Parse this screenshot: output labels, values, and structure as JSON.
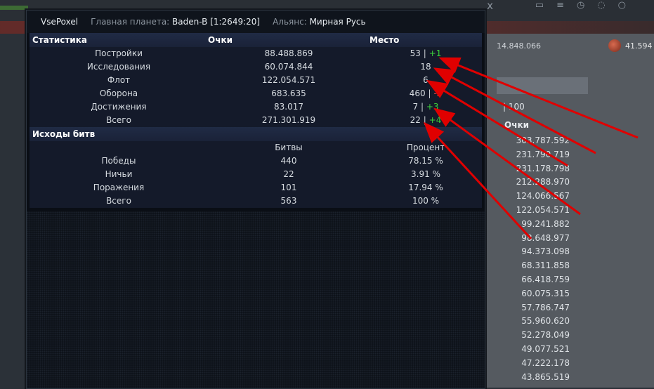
{
  "background": {
    "resource_value": "14.848.066",
    "resource_value_2": "41.594",
    "per_page": "| 100",
    "points_header": "Очки",
    "points_list": [
      "303.787.592",
      "231.790.719",
      "231.178.798",
      "212.288.970",
      "124.066.567",
      "122.054.571",
      "99.241.882",
      "98.648.977",
      "94.373.098",
      "68.311.858",
      "66.418.759",
      "60.075.315",
      "57.786.747",
      "55.960.620",
      "52.278.049",
      "49.077.521",
      "47.222.178",
      "43.865.519"
    ]
  },
  "modal": {
    "player_name": "VsePoxel",
    "home_planet_label": "Главная планета:",
    "home_planet_value": "Baden-B [1:2649:20]",
    "alliance_label": "Альянс:",
    "alliance_value": "Мирная Русь",
    "close_label": "x",
    "stats": {
      "headers": [
        "Статистика",
        "Очки",
        "Место"
      ],
      "rows": [
        {
          "label": "Постройки",
          "points": "88.488.869",
          "place": "53",
          "change": "+1",
          "change_type": "pos"
        },
        {
          "label": "Исследования",
          "points": "60.074.844",
          "place": "18",
          "change": "",
          "change_type": ""
        },
        {
          "label": "Флот",
          "points": "122.054.571",
          "place": "6",
          "change": "",
          "change_type": ""
        },
        {
          "label": "Оборона",
          "points": "683.635",
          "place": "460",
          "change": "-2",
          "change_type": "neg"
        },
        {
          "label": "Достижения",
          "points": "83.017",
          "place": "7",
          "change": "+3",
          "change_type": "pos"
        },
        {
          "label": "Всего",
          "points": "271.301.919",
          "place": "22",
          "change": "+4",
          "change_type": "pos"
        }
      ]
    },
    "battles": {
      "title": "Исходы битв",
      "col_headers": [
        "",
        "Битвы",
        "Процент"
      ],
      "rows": [
        {
          "label": "Победы",
          "count": "440",
          "percent": "78.15 %"
        },
        {
          "label": "Ничьи",
          "count": "22",
          "percent": "3.91 %"
        },
        {
          "label": "Поражения",
          "count": "101",
          "percent": "17.94 %"
        },
        {
          "label": "Всего",
          "count": "563",
          "percent": "100 %"
        }
      ]
    }
  },
  "colors": {
    "positive": "#3bd13b",
    "negative": "#e04040",
    "annotation_arrow": "#e00000"
  }
}
